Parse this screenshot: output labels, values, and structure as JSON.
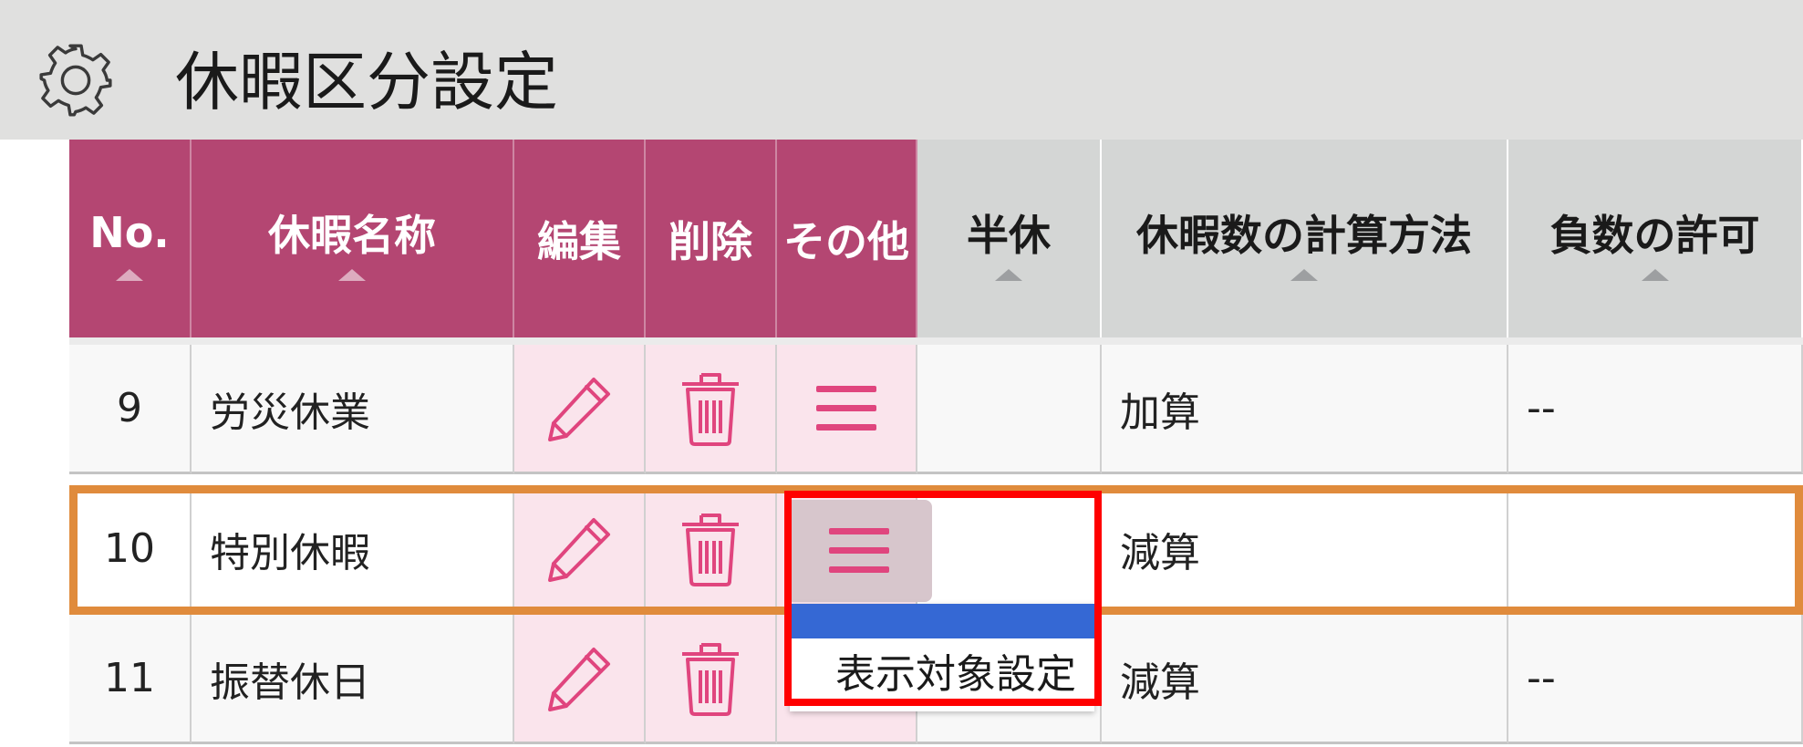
{
  "header": {
    "title": "休暇区分設定",
    "icon": "gear-icon"
  },
  "columns": {
    "no": "No.",
    "name": "休暇名称",
    "edit": "編集",
    "delete": "削除",
    "other": "その他",
    "half": "半休",
    "calc": "休暇数の計算方法",
    "negative": "負数の許可"
  },
  "rows": [
    {
      "no": "9",
      "name": "労災休業",
      "half": "",
      "calc": "加算",
      "negative": "--"
    },
    {
      "no": "10",
      "name": "特別休暇",
      "half": "",
      "calc": "減算",
      "negative": ""
    },
    {
      "no": "11",
      "name": "振替休日",
      "half": "",
      "calc": "減算",
      "negative": "--"
    }
  ],
  "dropdown": {
    "option": "表示対象設定"
  },
  "colors": {
    "header_accent": "#b44672",
    "action_cell_bg": "#fae4ec",
    "icon_color": "#e0457e",
    "selected_row_border": "#e08b3c",
    "highlight_blue": "#3568d4",
    "callout_red": "#ff0000"
  }
}
